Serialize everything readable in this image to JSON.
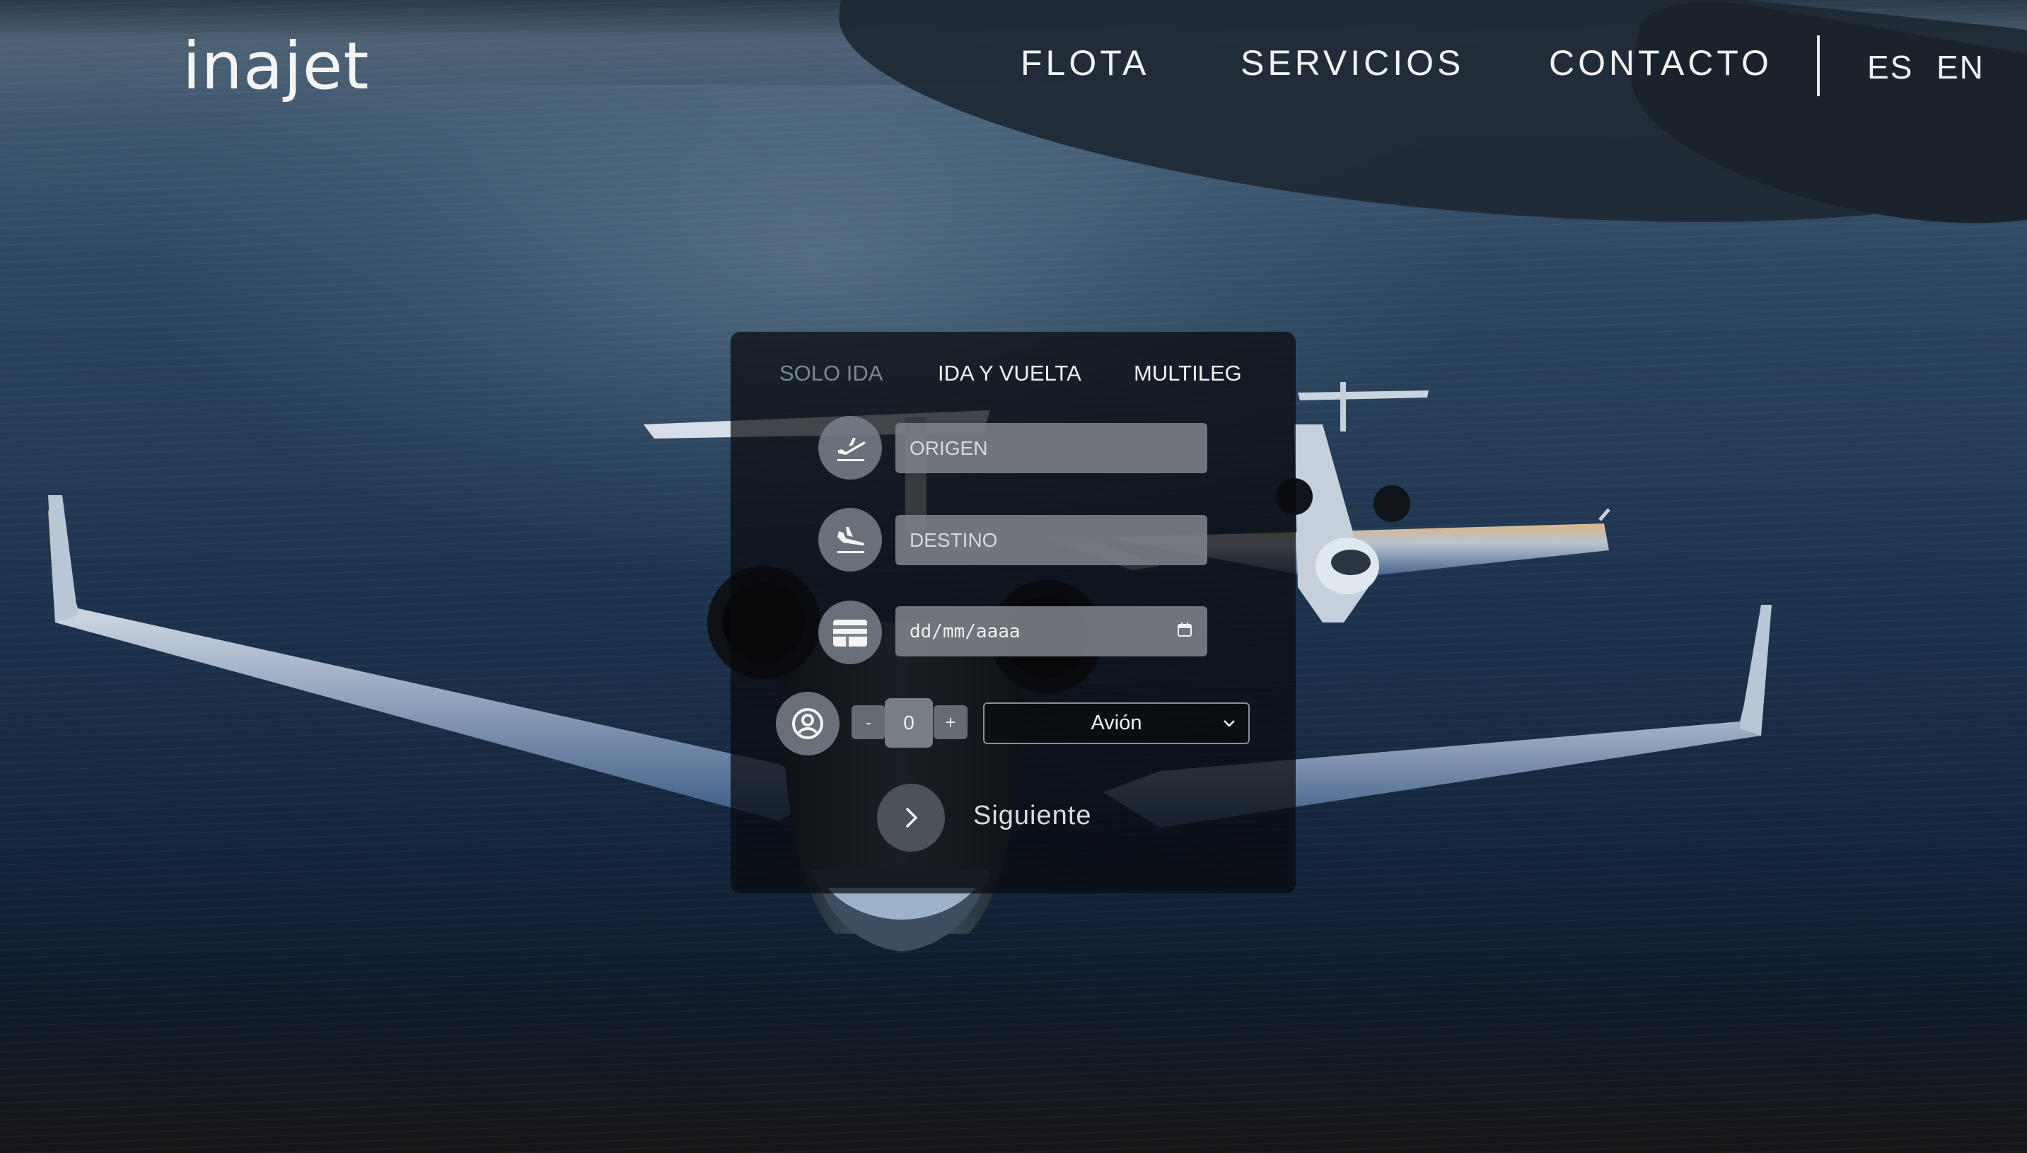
{
  "brand": {
    "logo_text": "inajet"
  },
  "nav": {
    "items": [
      {
        "label": "FLOTA"
      },
      {
        "label": "SERVICIOS"
      },
      {
        "label": "CONTACTO"
      }
    ],
    "languages": [
      {
        "label": "ES"
      },
      {
        "label": "EN"
      }
    ]
  },
  "booking": {
    "tabs": [
      {
        "label": "SOLO IDA",
        "active": false
      },
      {
        "label": "IDA Y VUELTA",
        "active": true
      },
      {
        "label": "MULTILEG",
        "active": true
      }
    ],
    "origin": {
      "placeholder": "ORIGEN",
      "icon": "takeoff-icon"
    },
    "destination": {
      "placeholder": "DESTINO",
      "icon": "landing-icon"
    },
    "date": {
      "placeholder": "dd/mm/aaaa",
      "icon": "calendar-card-icon"
    },
    "passengers": {
      "icon": "user-circle-icon",
      "decrement_label": "-",
      "value": "0",
      "increment_label": "+"
    },
    "aircraft_select": {
      "selected": "Avión"
    },
    "next": {
      "label": "Siguiente"
    }
  },
  "colors": {
    "panel_bg": "#0a0c0eb8",
    "field_bg": "#7d828a",
    "text": "#f2f2f2",
    "inactive_tab": "#7d8790"
  }
}
